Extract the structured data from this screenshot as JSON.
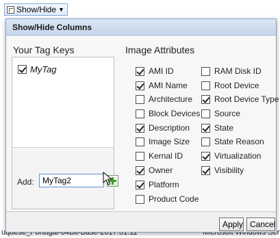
{
  "toolbar": {
    "show_hide_label": "Show/Hide",
    "show_hide_icon": "columns-icon",
    "dropdown_icon": "chevron-down-icon"
  },
  "background": {
    "bottom_left_text": "uquese_Portugal-64Bit-Base-2017.01.11",
    "bottom_right_text": "Microsoft Windows Serv",
    "right_column_glyph": "/"
  },
  "dialog": {
    "title": "Show/Hide Columns",
    "tag_keys": {
      "header": "Your Tag Keys",
      "items": [
        {
          "label": "MyTag",
          "checked": true
        }
      ],
      "add_label": "Add:",
      "add_value": "MyTag2",
      "add_button_icon": "plus-icon"
    },
    "image_attributes": {
      "header": "Image Attributes",
      "column1": [
        {
          "label": "AMI ID",
          "checked": true
        },
        {
          "label": "AMI Name",
          "checked": true
        },
        {
          "label": "Architecture",
          "checked": false
        },
        {
          "label": "Block Devices",
          "checked": false
        },
        {
          "label": "Description",
          "checked": true
        },
        {
          "label": "Image Size",
          "checked": false
        },
        {
          "label": "Kernal ID",
          "checked": false
        },
        {
          "label": "Owner",
          "checked": true
        },
        {
          "label": "Platform",
          "checked": true
        },
        {
          "label": "Product Code",
          "checked": false
        }
      ],
      "column2": [
        {
          "label": "RAM Disk ID",
          "checked": false
        },
        {
          "label": "Root Device",
          "checked": false
        },
        {
          "label": "Root Device Type",
          "checked": true
        },
        {
          "label": "Source",
          "checked": false
        },
        {
          "label": "State",
          "checked": true
        },
        {
          "label": "State Reason",
          "checked": false
        },
        {
          "label": "Virtualization",
          "checked": true
        },
        {
          "label": "Visibility",
          "checked": true
        }
      ]
    },
    "buttons": {
      "apply": "Apply",
      "cancel": "Cancel"
    }
  }
}
